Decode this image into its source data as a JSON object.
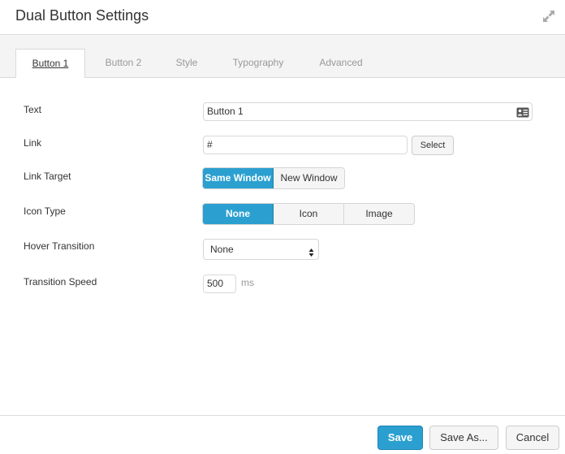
{
  "header": {
    "title": "Dual Button Settings",
    "expand_icon": "expand-arrows-icon"
  },
  "tabs": [
    {
      "label": "Button 1",
      "active": true
    },
    {
      "label": "Button 2",
      "active": false
    },
    {
      "label": "Style",
      "active": false
    },
    {
      "label": "Typography",
      "active": false
    },
    {
      "label": "Advanced",
      "active": false
    }
  ],
  "form": {
    "text": {
      "label": "Text",
      "value": "Button 1",
      "icon": "id-card-icon"
    },
    "link": {
      "label": "Link",
      "value": "#",
      "select_label": "Select"
    },
    "link_target": {
      "label": "Link Target",
      "options": [
        "Same Window",
        "New Window"
      ],
      "selected": "Same Window"
    },
    "icon_type": {
      "label": "Icon Type",
      "options": [
        "None",
        "Icon",
        "Image"
      ],
      "selected": "None"
    },
    "hover_transition": {
      "label": "Hover Transition",
      "value": "None"
    },
    "transition_speed": {
      "label": "Transition Speed",
      "value": "500",
      "unit": "ms"
    }
  },
  "footer": {
    "save_label": "Save",
    "save_as_label": "Save As...",
    "cancel_label": "Cancel"
  },
  "colors": {
    "accent": "#2ba0d0",
    "tabbar_bg": "#f4f4f4",
    "muted_text": "#999999"
  }
}
